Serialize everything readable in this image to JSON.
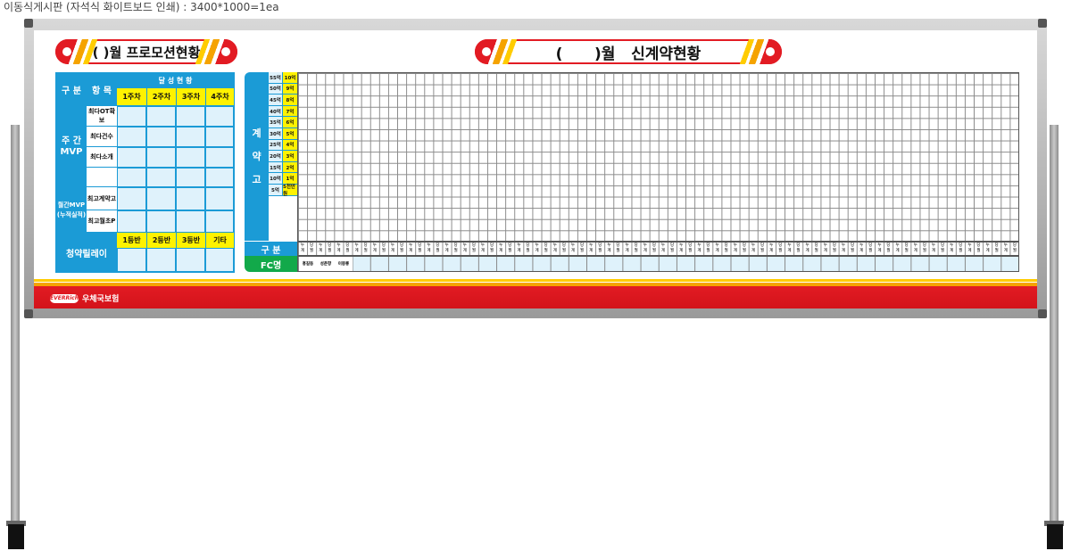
{
  "caption": "이동식게시판 (자석식 화이트보드 인쇄) : 3400*1000=1ea",
  "left_title": "(    )월  프로모션현황",
  "right_title": "(      )월   신계약현황",
  "left_panel": {
    "col_gubun": "구 분",
    "col_hangmok": "항 목",
    "achievement": "달 성 현 황",
    "weeks": [
      "1주차",
      "2주차",
      "3주차",
      "4주차"
    ],
    "weekly_mvp": "주 간\nMVP",
    "weekly_items": [
      "최다OT확보",
      "최다건수",
      "최다소개",
      ""
    ],
    "monthly_mvp": "월간MVP\n(누적실적)",
    "monthly_items": [
      "최고계약고",
      "최고월초P"
    ],
    "relay": "청약릴레이",
    "relay_cols": [
      "1등반",
      "2등반",
      "3등반",
      "기타"
    ]
  },
  "right_panel": {
    "vertical_label": [
      "계",
      "약",
      "고"
    ],
    "levels_a": [
      "55억",
      "50억",
      "45억",
      "40억",
      "35억",
      "30억",
      "25억",
      "20억",
      "15억",
      "10억",
      "5억"
    ],
    "levels_b": [
      "10억",
      "9억",
      "8억",
      "7억",
      "6억",
      "5억",
      "4억",
      "3억",
      "2억",
      "1억",
      "5천만원"
    ],
    "gubun_label": "구 분",
    "gubun_pair": [
      "누계",
      "당월"
    ],
    "fc_label": "FC명",
    "fc_names": [
      "홍길동",
      "성춘향",
      "이몽룡"
    ]
  },
  "brand": {
    "logo": "EVERRich",
    "name": "우체국보험"
  },
  "colors": {
    "blue": "#1b9bd6",
    "yellow": "#fff200",
    "red": "#e21b23",
    "green": "#12a94a",
    "orange": "#f5a300"
  }
}
